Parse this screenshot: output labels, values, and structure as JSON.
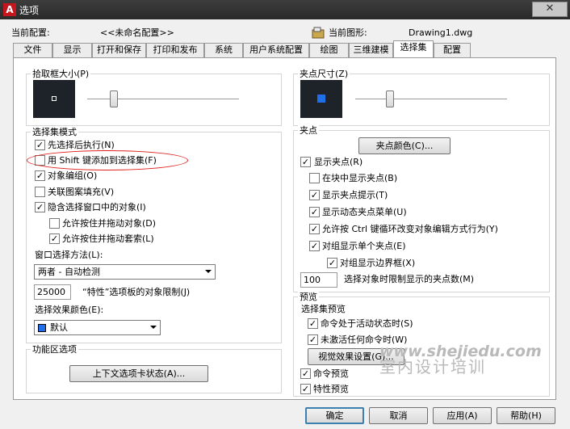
{
  "window": {
    "title": "选项",
    "app_icon": "A"
  },
  "profile": {
    "label": "当前配置:",
    "value": "<<未命名配置>>"
  },
  "drawing": {
    "label": "当前图形:",
    "value": "Drawing1.dwg"
  },
  "tabs": [
    {
      "label": "文件"
    },
    {
      "label": "显示"
    },
    {
      "label": "打开和保存"
    },
    {
      "label": "打印和发布"
    },
    {
      "label": "系统"
    },
    {
      "label": "用户系统配置"
    },
    {
      "label": "绘图"
    },
    {
      "label": "三维建模"
    },
    {
      "label": "选择集"
    },
    {
      "label": "配置"
    }
  ],
  "pickbox": {
    "title": "拾取框大小(P)"
  },
  "grip_size": {
    "title": "夹点尺寸(Z)",
    "preview_color": "#1f6fe8"
  },
  "selection_modes": {
    "title": "选择集模式",
    "items": [
      {
        "label": "先选择后执行(N)",
        "checked": "✓"
      },
      {
        "label": "用 Shift 键添加到选择集(F)",
        "checked": ""
      },
      {
        "label": "对象编组(O)",
        "checked": "✓"
      },
      {
        "label": "关联图案填充(V)",
        "checked": ""
      },
      {
        "label": "隐含选择窗口中的对象(I)",
        "checked": "✓"
      },
      {
        "label": "允许按住并拖动对象(D)",
        "checked": ""
      },
      {
        "label": "允许按住并拖动套索(L)",
        "checked": "✓"
      }
    ],
    "window_method_label": "窗口选择方法(L):",
    "window_method_value": "两者 - 自动检测",
    "limit_value": "25000",
    "limit_label": "“特性”选项板的对象限制(J)",
    "effect_color_label": "选择效果颜色(E):",
    "effect_color_value": "默认",
    "effect_color_swatch": "#1f6fe8"
  },
  "ribbon": {
    "title": "功能区选项",
    "button": "上下文选项卡状态(A)..."
  },
  "grips": {
    "title": "夹点",
    "color_button": "夹点颜色(C)...",
    "items": [
      {
        "label": "显示夹点(R)",
        "checked": "✓"
      },
      {
        "label": "在块中显示夹点(B)",
        "checked": ""
      },
      {
        "label": "显示夹点提示(T)",
        "checked": "✓"
      },
      {
        "label": "显示动态夹点菜单(U)",
        "checked": "✓"
      },
      {
        "label": "允许按 Ctrl 键循环改变对象编辑方式行为(Y)",
        "checked": "✓"
      },
      {
        "label": "对组显示单个夹点(E)",
        "checked": "✓"
      },
      {
        "label": "对组显示边界框(X)",
        "checked": "✓"
      }
    ],
    "limit_value": "100",
    "limit_label": "选择对象时限制显示的夹点数(M)"
  },
  "preview": {
    "title": "预览",
    "subtitle": "选择集预览",
    "items": [
      {
        "label": "命令处于活动状态时(S)",
        "checked": "✓"
      },
      {
        "label": "未激活任何命令时(W)",
        "checked": "✓"
      }
    ],
    "effects_button": "视觉效果设置(G)...",
    "command_preview": {
      "label": "命令预览",
      "checked": "✓"
    },
    "property_preview": {
      "label": "特性预览",
      "checked": "✓"
    }
  },
  "footer": {
    "ok": "确定",
    "cancel": "取消",
    "apply": "应用(A)",
    "help": "帮助(H)"
  },
  "watermark": {
    "line1": "www.shejiedu.com",
    "line2": "室内设计培训"
  },
  "colors": {
    "annotation_ellipse": "#e0201c",
    "preview_bg": "#1e2329"
  }
}
